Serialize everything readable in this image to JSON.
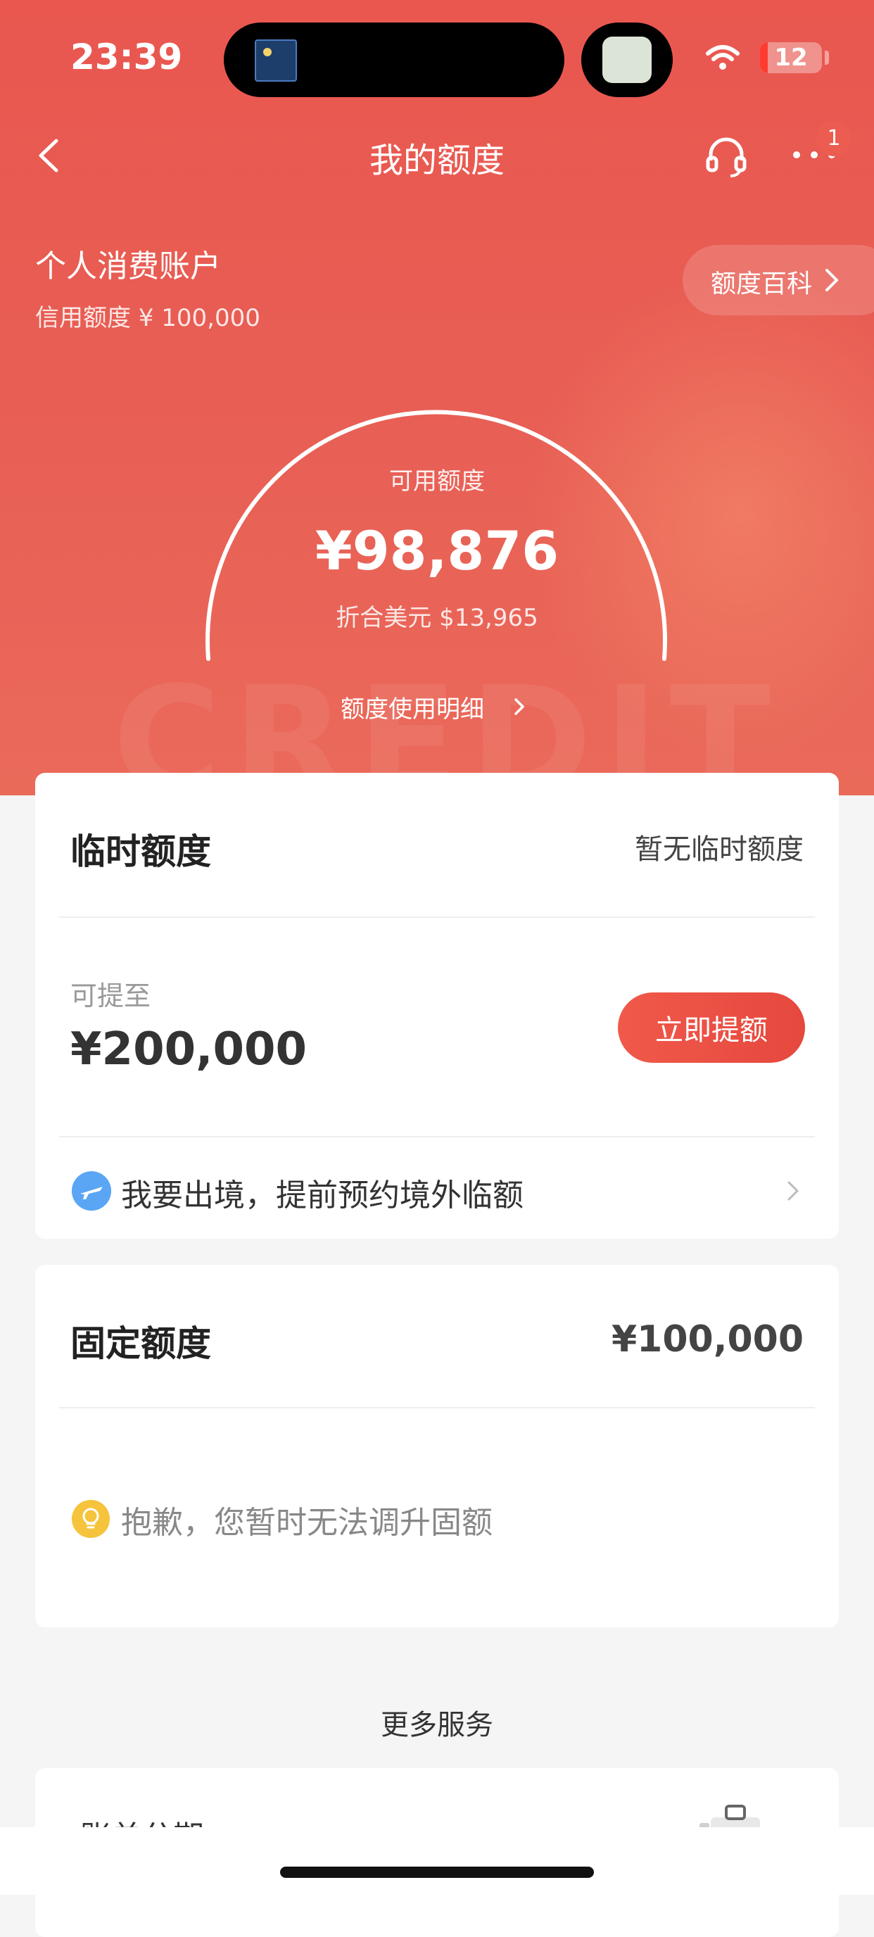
{
  "status_bar": {
    "time": "23:39",
    "battery": "12",
    "battery_level": 0.12
  },
  "nav": {
    "title": "我的额度",
    "more_badge": "1"
  },
  "account": {
    "title": "个人消费账户",
    "credit_limit": "信用额度 ¥ 100,000",
    "encyclopedia_label": "额度百科"
  },
  "available": {
    "label": "可用额度",
    "amount": "¥98,876",
    "usd": "折合美元 $13,965",
    "usage_link": "额度使用明细"
  },
  "temporary": {
    "title": "临时额度",
    "status": "暂无临时额度",
    "max_label": "可提至",
    "max_amount": "¥200,000",
    "raise_button": "立即提额",
    "overseas_text": "我要出境，提前预约境外临额"
  },
  "fixed": {
    "title": "固定额度",
    "amount": "¥100,000",
    "notice": "抱歉，您暂时无法调升固额"
  },
  "more_services": {
    "title": "更多服务",
    "first_item": "账单分期"
  },
  "colors": {
    "hero": "#e9574f",
    "accent_button": "#e6483e",
    "page_bg": "#f5f5f5"
  }
}
